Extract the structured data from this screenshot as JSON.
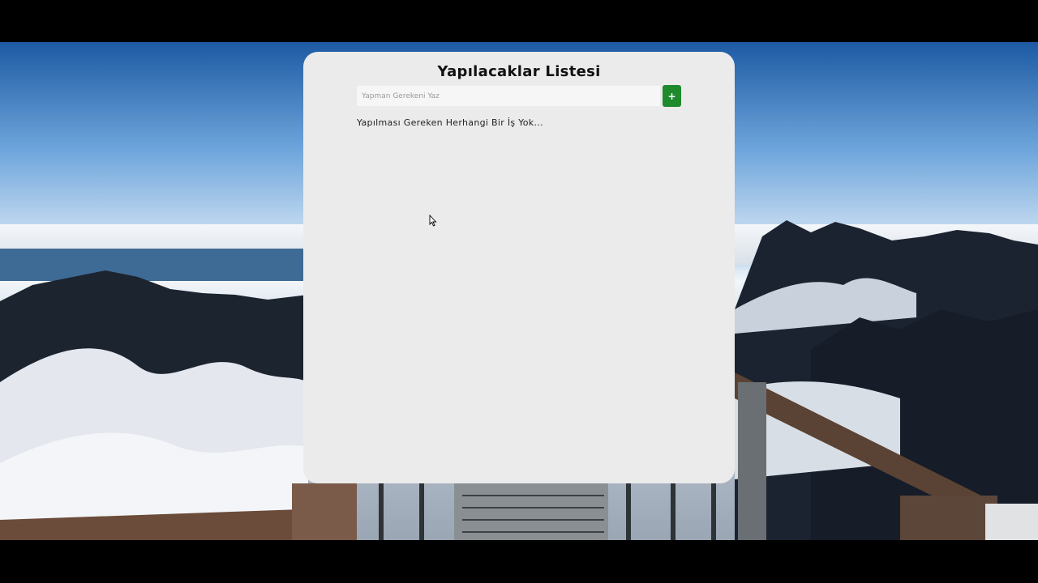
{
  "app": {
    "title": "Yapılacaklar Listesi"
  },
  "form": {
    "input_placeholder": "Yapman Gerekeni Yaz",
    "input_value": "",
    "add_button_label": "+"
  },
  "list": {
    "empty_message": "Yapılması Gereken Herhangi Bir İş Yok..."
  },
  "colors": {
    "add_button": "#1f8a2c",
    "card_background": "#ebebeb"
  },
  "icons": {
    "cursor": "mouse-pointer-icon"
  }
}
